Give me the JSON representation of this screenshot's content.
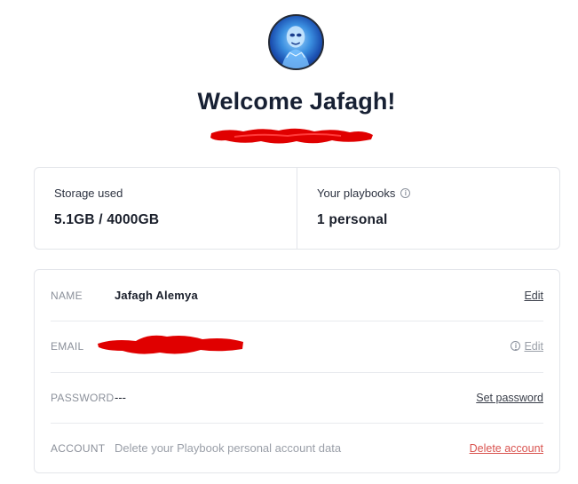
{
  "header": {
    "welcome": "Welcome Jafagh!"
  },
  "stats": {
    "storage_label": "Storage used",
    "storage_value": "5.1GB / 4000GB",
    "playbooks_label": "Your playbooks",
    "playbooks_value": "1 personal"
  },
  "account": {
    "name_label": "NAME",
    "name_value": "Jafagh Alemya",
    "name_action": "Edit",
    "email_label": "EMAIL",
    "email_action": "Edit",
    "password_label": "PASSWORD",
    "password_value": "---",
    "password_action": "Set password",
    "account_label": "ACCOUNT",
    "account_value": "Delete your Playbook personal account data",
    "account_action": "Delete account"
  },
  "icons": {
    "info": "i"
  },
  "colors": {
    "danger": "#d9534f",
    "redaction": "#e00000"
  }
}
